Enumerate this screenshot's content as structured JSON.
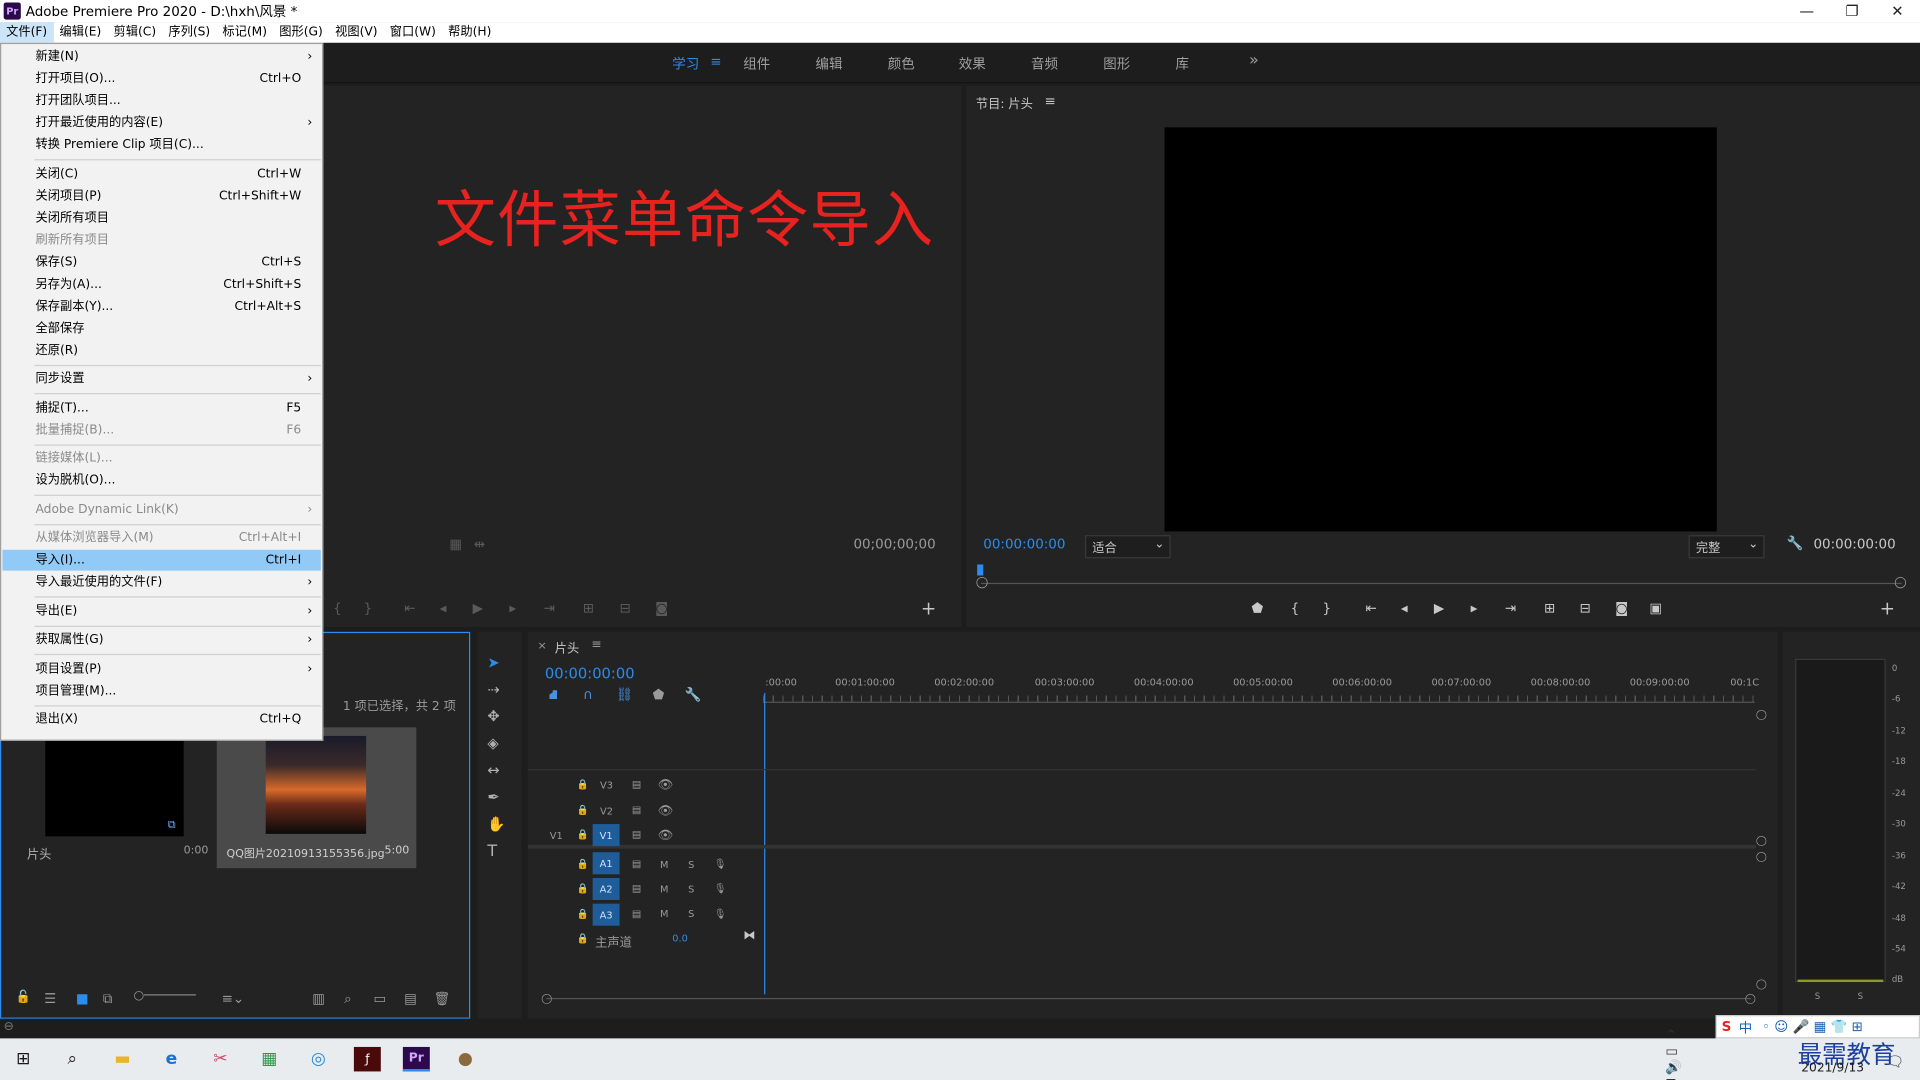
{
  "window": {
    "title": "Adobe Premiere Pro 2020 - D:\\hxh\\风景 *",
    "app_icon": "Pr",
    "controls": [
      "—",
      "❐",
      "✕"
    ]
  },
  "menubar": [
    "文件(F)",
    "编辑(E)",
    "剪辑(C)",
    "序列(S)",
    "标记(M)",
    "图形(G)",
    "视图(V)",
    "窗口(W)",
    "帮助(H)"
  ],
  "workspaces": {
    "tabs": [
      "学习",
      "组件",
      "编辑",
      "颜色",
      "效果",
      "音频",
      "图形",
      "库"
    ],
    "active": "学习",
    "more": "»",
    "menu_glyph": "≡"
  },
  "file_menu": [
    {
      "label": "新建(N)",
      "shortcut": "",
      "submenu": true,
      "disabled": false
    },
    {
      "label": "打开项目(O)...",
      "shortcut": "Ctrl+O",
      "submenu": false,
      "disabled": false
    },
    {
      "label": "打开团队项目...",
      "shortcut": "",
      "submenu": false,
      "disabled": false
    },
    {
      "label": "打开最近使用的内容(E)",
      "shortcut": "",
      "submenu": true,
      "disabled": false
    },
    {
      "label": "转换 Premiere Clip 项目(C)...",
      "shortcut": "",
      "submenu": false,
      "disabled": false
    },
    {
      "label": "关闭(C)",
      "shortcut": "Ctrl+W",
      "submenu": false,
      "disabled": false
    },
    {
      "label": "关闭项目(P)",
      "shortcut": "Ctrl+Shift+W",
      "submenu": false,
      "disabled": false
    },
    {
      "label": "关闭所有项目",
      "shortcut": "",
      "submenu": false,
      "disabled": false
    },
    {
      "label": "刷新所有项目",
      "shortcut": "",
      "submenu": false,
      "disabled": true
    },
    {
      "label": "保存(S)",
      "shortcut": "Ctrl+S",
      "submenu": false,
      "disabled": false
    },
    {
      "label": "另存为(A)...",
      "shortcut": "Ctrl+Shift+S",
      "submenu": false,
      "disabled": false
    },
    {
      "label": "保存副本(Y)...",
      "shortcut": "Ctrl+Alt+S",
      "submenu": false,
      "disabled": false
    },
    {
      "label": "全部保存",
      "shortcut": "",
      "submenu": false,
      "disabled": false
    },
    {
      "label": "还原(R)",
      "shortcut": "",
      "submenu": false,
      "disabled": false
    },
    {
      "label": "同步设置",
      "shortcut": "",
      "submenu": true,
      "disabled": false
    },
    {
      "label": "捕捉(T)...",
      "shortcut": "F5",
      "submenu": false,
      "disabled": false
    },
    {
      "label": "批量捕捉(B)...",
      "shortcut": "F6",
      "submenu": false,
      "disabled": true
    },
    {
      "label": "链接媒体(L)...",
      "shortcut": "",
      "submenu": false,
      "disabled": true
    },
    {
      "label": "设为脱机(O)...",
      "shortcut": "",
      "submenu": false,
      "disabled": false
    },
    {
      "label": "Adobe Dynamic Link(K)",
      "shortcut": "",
      "submenu": true,
      "disabled": true
    },
    {
      "label": "从媒体浏览器导入(M)",
      "shortcut": "Ctrl+Alt+I",
      "submenu": false,
      "disabled": true
    },
    {
      "label": "导入(I)...",
      "shortcut": "Ctrl+I",
      "submenu": false,
      "disabled": false,
      "highlighted": true
    },
    {
      "label": "导入最近使用的文件(F)",
      "shortcut": "",
      "submenu": true,
      "disabled": false
    },
    {
      "label": "导出(E)",
      "shortcut": "",
      "submenu": true,
      "disabled": false
    },
    {
      "label": "获取属性(G)",
      "shortcut": "",
      "submenu": true,
      "disabled": false
    },
    {
      "label": "项目设置(P)",
      "shortcut": "",
      "submenu": true,
      "disabled": false
    },
    {
      "label": "项目管理(M)...",
      "shortcut": "",
      "submenu": false,
      "disabled": false
    },
    {
      "label": "退出(X)",
      "shortcut": "Ctrl+Q",
      "submenu": false,
      "disabled": false
    }
  ],
  "annotation": "文件菜单命令导入",
  "source_monitor": {
    "timecode": "00;00;00;00"
  },
  "program_monitor": {
    "title": "节目: 片头",
    "timecode_left": "00:00:00:00",
    "fit": "适合",
    "quality": "完整",
    "timecode_right": "00:00:00:00"
  },
  "project_panel": {
    "selection_status": "1 项已选择，共 2 项",
    "items": [
      {
        "name": "片头",
        "duration": "0:00"
      },
      {
        "name": "QQ图片20210913155356.jpg",
        "duration": "5:00"
      }
    ]
  },
  "timeline": {
    "sequence_name": "片头",
    "timecode": "00:00:00:00",
    "ruler": [
      ":00:00",
      "00:01:00:00",
      "00:02:00:00",
      "00:03:00:00",
      "00:04:00:00",
      "00:05:00:00",
      "00:06:00:00",
      "00:07:00:00",
      "00:08:00:00",
      "00:09:00:00",
      "00:1C"
    ],
    "video_tracks": [
      "V3",
      "V2",
      "V1"
    ],
    "audio_tracks": [
      "A1",
      "A2",
      "A3"
    ],
    "source_patch": "V1",
    "master": {
      "label": "主声道",
      "value": "0.0"
    },
    "mute_label": "M",
    "solo_label": "S"
  },
  "audio_meter": {
    "scale": [
      "0",
      "-6",
      "-12",
      "-18",
      "-24",
      "-30",
      "-36",
      "-42",
      "-48",
      "-54",
      "dB"
    ],
    "solo": [
      "S",
      "S"
    ]
  },
  "taskbar": {
    "date": "2021/9/13",
    "watermark": "最需教育",
    "ime": "中"
  }
}
